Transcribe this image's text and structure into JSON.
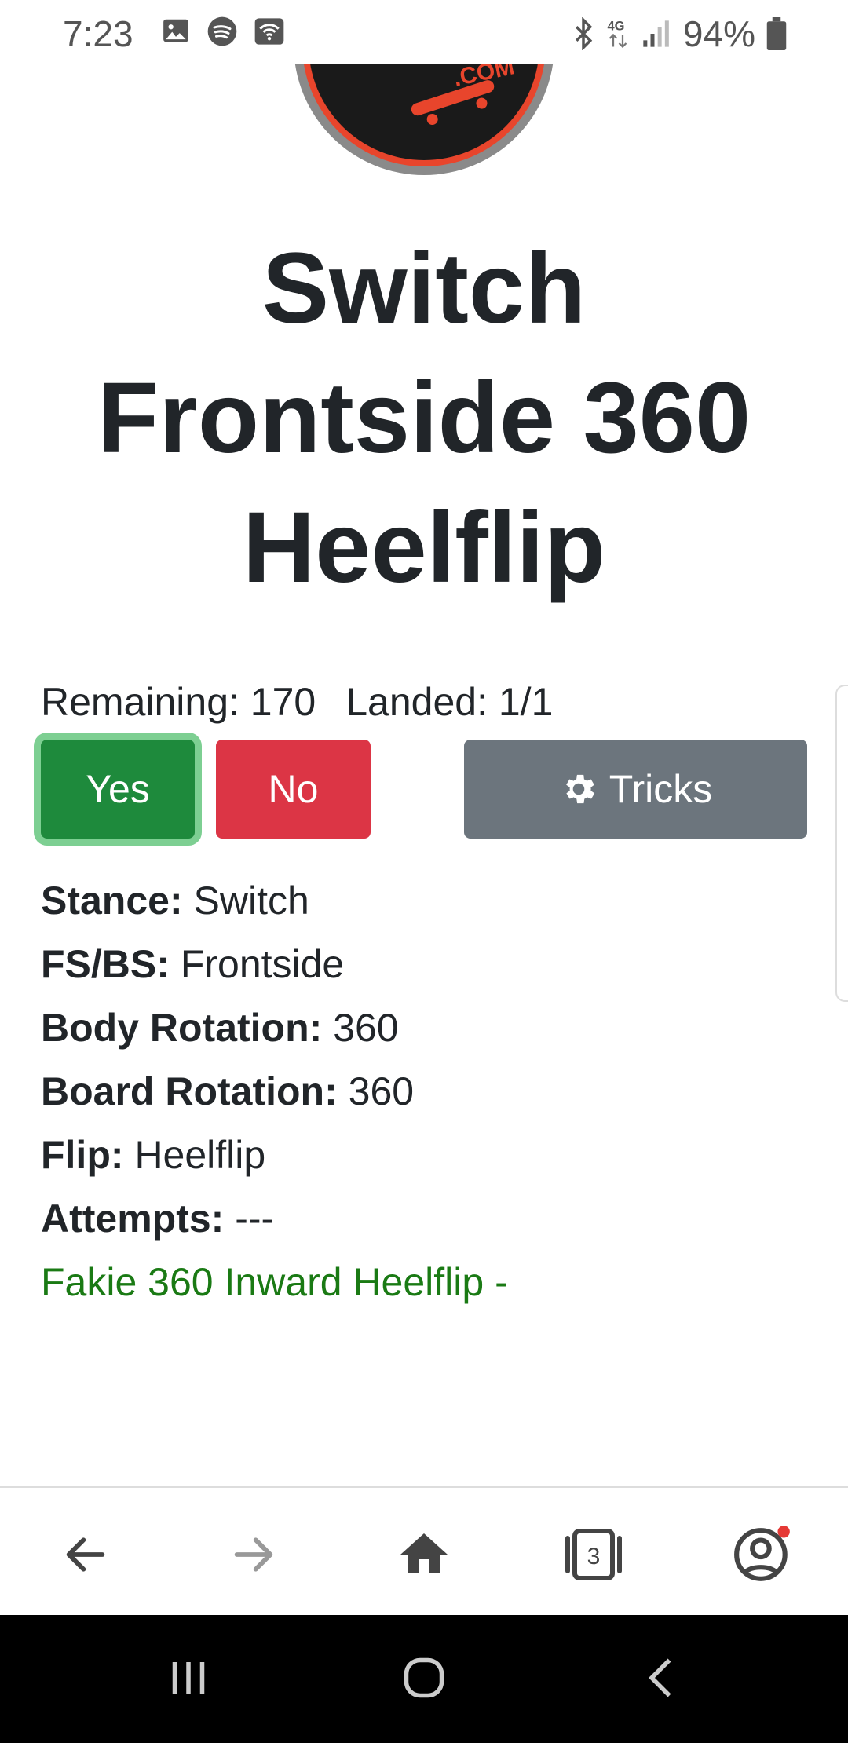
{
  "status_bar": {
    "time": "7:23",
    "battery": "94%",
    "network": "4G",
    "left_icons": [
      "image-icon",
      "spotify-icon",
      "wifi-calling-icon"
    ],
    "right_icons": [
      "bluetooth-icon",
      "signal-icon",
      "battery-icon"
    ]
  },
  "trick": {
    "title": "Switch Frontside 360 Heelflip",
    "remaining_label": "Remaining: 170",
    "landed_label": "Landed: 1/1"
  },
  "buttons": {
    "yes": "Yes",
    "no": "No",
    "tricks": "Tricks"
  },
  "details": [
    {
      "label": "Stance:",
      "value": "Switch"
    },
    {
      "label": "FS/BS:",
      "value": "Frontside"
    },
    {
      "label": "Body Rotation:",
      "value": "360"
    },
    {
      "label": "Board Rotation:",
      "value": "360"
    },
    {
      "label": "Flip:",
      "value": "Heelflip"
    },
    {
      "label": "Attempts:",
      "value": "---"
    }
  ],
  "related_trick": "Fakie 360 Inward Heelflip  -",
  "logo_text": ".COM",
  "browser_nav": {
    "tab_count": "3",
    "items": [
      "back-arrow-icon",
      "forward-arrow-icon",
      "home-icon",
      "tabs-icon",
      "account-icon"
    ]
  },
  "colors": {
    "yes": "#1e8a3c",
    "no": "#dc3545",
    "tricks": "#6c757d",
    "related_link": "#1a7a14",
    "logo_accent": "#e8452c"
  }
}
